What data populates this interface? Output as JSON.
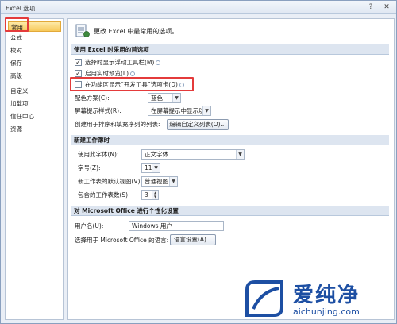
{
  "window": {
    "title": "Excel 选项",
    "help_glyph": "?",
    "close_glyph": "✕"
  },
  "sidebar": {
    "items": [
      {
        "label": "常用",
        "selected": true
      },
      {
        "label": "公式"
      },
      {
        "label": "校对"
      },
      {
        "label": "保存"
      },
      {
        "label": "高级"
      },
      {
        "label": "自定义"
      },
      {
        "label": "加载项"
      },
      {
        "label": "信任中心"
      },
      {
        "label": "资源"
      }
    ]
  },
  "header": {
    "title": "更改 Excel 中最常用的选项。",
    "icon": "options-document-icon"
  },
  "top_section": {
    "title": "使用 Excel 时采用的首选项",
    "checkboxes": [
      {
        "label": "选择时显示浮动工具栏(M)",
        "checked": true
      },
      {
        "label": "启用实时预览(L)",
        "checked": true
      },
      {
        "label": "在功能区显示“开发工具”选项卡(D)",
        "checked": false
      }
    ],
    "color_scheme_label": "配色方案(C):",
    "color_scheme_value": "蓝色",
    "screentip_label": "屏幕提示样式(R):",
    "screentip_value": "在屏幕提示中显示功能说明",
    "custom_list_label": "创建用于排序和填充序列的列表:",
    "custom_list_button": "编辑自定义列表(O)..."
  },
  "new_workbook_section": {
    "title": "新建工作簿时",
    "font_label": "使用此字体(N):",
    "font_value": "正文字体",
    "size_label": "字号(Z):",
    "size_value": "11",
    "view_label": "新工作表的默认视图(V):",
    "view_value": "普通视图",
    "sheets_label": "包含的工作表数(S):",
    "sheets_value": "3"
  },
  "personalize_section": {
    "title": "对 Microsoft Office 进行个性化设置",
    "username_label": "用户名(U):",
    "username_value": "Windows 用户",
    "language_label": "选择用于 Microsoft Office 的语言:",
    "language_button": "语言设置(A)..."
  },
  "watermark": {
    "title": "爱纯净",
    "url": "aichunjing.com"
  },
  "colors": {
    "highlight": "#e43b3b",
    "accent": "#1d4fa3",
    "selected": "#f7c95a"
  }
}
